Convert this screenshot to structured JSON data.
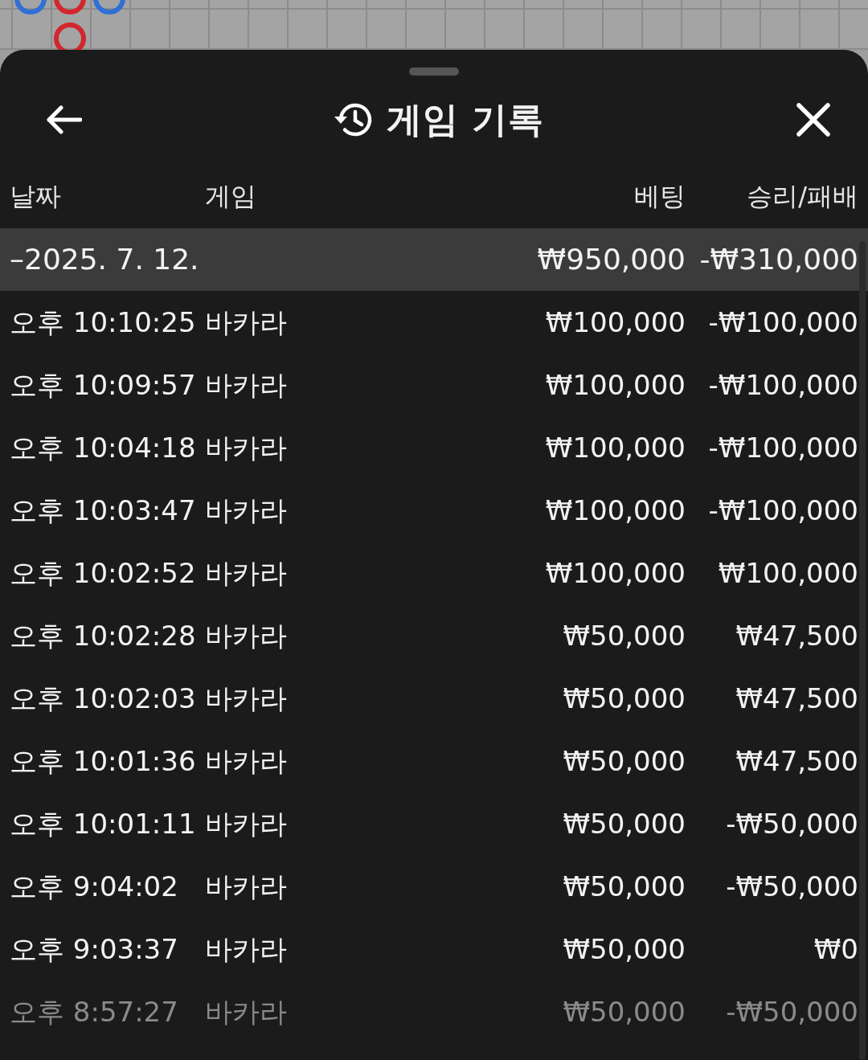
{
  "board": {
    "road": [
      {
        "beads": [
          {
            "color": "#2f6fd6"
          }
        ]
      },
      {
        "beads": [
          {
            "color": "#d3262e"
          },
          {
            "color": "#d3262e"
          }
        ]
      },
      {
        "beads": [
          {
            "color": "#2f6fd6"
          }
        ]
      }
    ]
  },
  "sheet": {
    "title": "게임 기록"
  },
  "columns": [
    "날짜",
    "게임",
    "베팅",
    "승리/패배"
  ],
  "group": {
    "toggle": "–",
    "date": "2025. 7. 12.",
    "expanded": true,
    "bet": "₩950,000",
    "result": "-₩310,000"
  },
  "rows": [
    {
      "time": "오후 10:10:25",
      "game": "바카라",
      "bet": "₩100,000",
      "result": "-₩100,000",
      "dimmed": false
    },
    {
      "time": "오후 10:09:57",
      "game": "바카라",
      "bet": "₩100,000",
      "result": "-₩100,000",
      "dimmed": false
    },
    {
      "time": "오후 10:04:18",
      "game": "바카라",
      "bet": "₩100,000",
      "result": "-₩100,000",
      "dimmed": false
    },
    {
      "time": "오후 10:03:47",
      "game": "바카라",
      "bet": "₩100,000",
      "result": "-₩100,000",
      "dimmed": false
    },
    {
      "time": "오후 10:02:52",
      "game": "바카라",
      "bet": "₩100,000",
      "result": "₩100,000",
      "dimmed": false
    },
    {
      "time": "오후 10:02:28",
      "game": "바카라",
      "bet": "₩50,000",
      "result": "₩47,500",
      "dimmed": false
    },
    {
      "time": "오후 10:02:03",
      "game": "바카라",
      "bet": "₩50,000",
      "result": "₩47,500",
      "dimmed": false
    },
    {
      "time": "오후 10:01:36",
      "game": "바카라",
      "bet": "₩50,000",
      "result": "₩47,500",
      "dimmed": false
    },
    {
      "time": "오후 10:01:11",
      "game": "바카라",
      "bet": "₩50,000",
      "result": "-₩50,000",
      "dimmed": false
    },
    {
      "time": "오후 9:04:02",
      "game": "바카라",
      "bet": "₩50,000",
      "result": "-₩50,000",
      "dimmed": false
    },
    {
      "time": "오후 9:03:37",
      "game": "바카라",
      "bet": "₩50,000",
      "result": "₩0",
      "dimmed": false
    },
    {
      "time": "오후 8:57:27",
      "game": "바카라",
      "bet": "₩50,000",
      "result": "-₩50,000",
      "dimmed": true
    }
  ]
}
